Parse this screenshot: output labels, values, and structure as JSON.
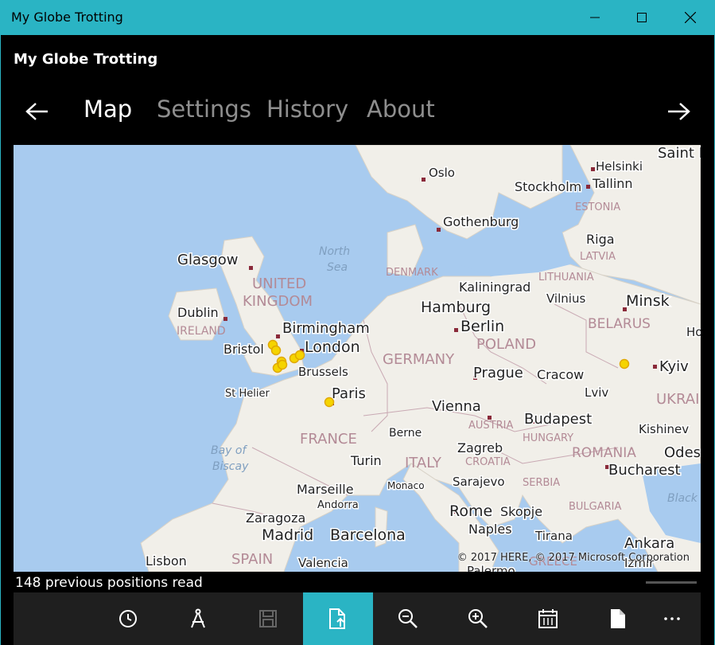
{
  "window": {
    "title": "My Globe Trotting",
    "controls": [
      "minimize-icon",
      "maximize-icon",
      "close-icon"
    ]
  },
  "app": {
    "name": "My Globe Trotting"
  },
  "nav": {
    "back_icon": "arrow-left-icon",
    "forward_icon": "arrow-right-icon",
    "tabs": [
      {
        "label": "Map",
        "active": true
      },
      {
        "label": "Settings",
        "active": false
      },
      {
        "label": "History",
        "active": false
      },
      {
        "label": "About",
        "active": false
      }
    ]
  },
  "map": {
    "cities": {
      "oslo": "Oslo",
      "helsinki": "Helsinki",
      "saint_peters": "Saint Peters",
      "stockholm": "Stockholm",
      "tallinn": "Tallinn",
      "gothenburg": "Gothenburg",
      "riga": "Riga",
      "glasgow": "Glasgow",
      "kaliningrad": "Kaliningrad",
      "vilnius": "Vilnius",
      "minsk": "Minsk",
      "dublin": "Dublin",
      "hamburg": "Hamburg",
      "birmingham": "Birmingham",
      "berlin": "Berlin",
      "homy": "Homy",
      "bristol": "Bristol",
      "london": "London",
      "brussels": "Brussels",
      "prague": "Prague",
      "cracow": "Cracow",
      "kyiv": "Kyiv",
      "st_helier": "St Helier",
      "paris": "Paris",
      "lviv": "Lviv",
      "vienna": "Vienna",
      "budapest": "Budapest",
      "berne": "Berne",
      "zagreb": "Zagreb",
      "kishinev": "Kishinev",
      "odes": "Odes",
      "turin": "Turin",
      "bucharest": "Bucharest",
      "marseille": "Marseille",
      "monaco": "Monaco",
      "sarajevo": "Sarajevo",
      "andorra": "Andorra",
      "rome": "Rome",
      "skopje": "Skopje",
      "zaragoza": "Zaragoza",
      "naples": "Naples",
      "madrid": "Madrid",
      "barcelona": "Barcelona",
      "tirana": "Tirana",
      "ankara": "Ankara",
      "lisbon": "Lisbon",
      "valencia": "Valencia",
      "izmir": "Izmir",
      "palermo": "Palermo"
    },
    "countries": {
      "estonia": "ESTONIA",
      "latvia": "LATVIA",
      "lithuania": "LITHUANIA",
      "denmark": "DENMARK",
      "united": "UNITED",
      "kingdom": "KINGDOM",
      "ireland": "IRELAND",
      "belarus": "BELARUS",
      "poland": "POLAND",
      "germany": "GERMANY",
      "ukraine": "UKRAINE",
      "austria": "AUSTRIA",
      "hungary": "HUNGARY",
      "france": "FRANCE",
      "croatia": "CROATIA",
      "romania": "ROMANIA",
      "italy": "ITALY",
      "serbia": "SERBIA",
      "bulgaria": "BULGARIA",
      "spain": "SPAIN",
      "greece": "GREECE"
    },
    "water": {
      "north": "North",
      "sea": "Sea",
      "bay_of": "Bay of",
      "biscay": "Biscay",
      "black": "Black"
    },
    "copyright": "© 2017 HERE, © 2017 Microsoft Corporation",
    "marker_color": "#f5d400"
  },
  "status": {
    "text": "148 previous positions read"
  },
  "commandbar": {
    "buttons": [
      {
        "icon": "clock-icon",
        "active": false
      },
      {
        "icon": "compass-icon",
        "active": false
      },
      {
        "icon": "save-icon",
        "active": false,
        "disabled": true
      },
      {
        "icon": "file-upload-icon",
        "active": true
      },
      {
        "icon": "zoom-out-icon",
        "active": false
      },
      {
        "icon": "zoom-in-icon",
        "active": false
      },
      {
        "icon": "calendar-icon",
        "active": false
      },
      {
        "icon": "document-icon",
        "active": false
      },
      {
        "icon": "more-icon",
        "active": false
      }
    ]
  },
  "colors": {
    "accent": "#2ab4c4",
    "background": "#000000",
    "tab_inactive": "#8e8e8e"
  }
}
